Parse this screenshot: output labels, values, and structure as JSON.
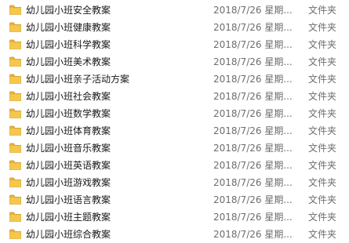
{
  "folder_color": "#e8b33a",
  "files": [
    {
      "name": "幼儿园小班安全教案",
      "date": "2018/7/26 星期...",
      "type": "文件夹",
      "icon": "folder-icon"
    },
    {
      "name": "幼儿园小班健康教案",
      "date": "2018/7/26 星期...",
      "type": "文件夹",
      "icon": "folder-icon"
    },
    {
      "name": "幼儿园小班科学教案",
      "date": "2018/7/26 星期...",
      "type": "文件夹",
      "icon": "folder-icon"
    },
    {
      "name": "幼儿园小班美术教案",
      "date": "2018/7/26 星期...",
      "type": "文件夹",
      "icon": "folder-icon"
    },
    {
      "name": "幼儿园小班亲子活动方案",
      "date": "2018/7/26 星期...",
      "type": "文件夹",
      "icon": "folder-icon"
    },
    {
      "name": "幼儿园小班社会教案",
      "date": "2018/7/26 星期...",
      "type": "文件夹",
      "icon": "folder-icon"
    },
    {
      "name": "幼儿园小班数学教案",
      "date": "2018/7/26 星期...",
      "type": "文件夹",
      "icon": "folder-icon"
    },
    {
      "name": "幼儿园小班体育教案",
      "date": "2018/7/26 星期...",
      "type": "文件夹",
      "icon": "folder-icon"
    },
    {
      "name": "幼儿园小班音乐教案",
      "date": "2018/7/26 星期...",
      "type": "文件夹",
      "icon": "folder-icon"
    },
    {
      "name": "幼儿园小班英语教案",
      "date": "2018/7/26 星期...",
      "type": "文件夹",
      "icon": "folder-icon"
    },
    {
      "name": "幼儿园小班游戏教案",
      "date": "2018/7/26 星期...",
      "type": "文件夹",
      "icon": "folder-icon"
    },
    {
      "name": "幼儿园小班语言教案",
      "date": "2018/7/26 星期...",
      "type": "文件夹",
      "icon": "folder-icon"
    },
    {
      "name": "幼儿园小班主题教案",
      "date": "2018/7/26 星期...",
      "type": "文件夹",
      "icon": "folder-icon"
    },
    {
      "name": "幼儿园小班综合教案",
      "date": "2018/7/26 星期...",
      "type": "文件夹",
      "icon": "folder-icon"
    }
  ]
}
